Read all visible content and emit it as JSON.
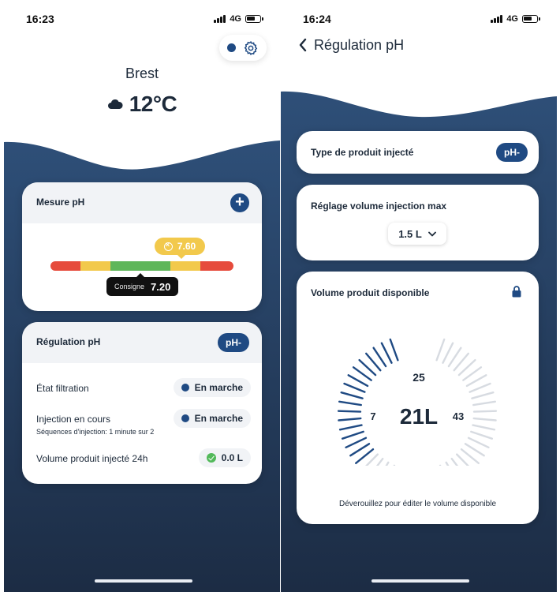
{
  "screen1": {
    "status": {
      "time": "16:23",
      "network": "4G"
    },
    "city": "Brest",
    "weather": {
      "icon": "cloud-icon",
      "temperature": "12°C"
    },
    "mesure_card": {
      "title": "Mesure pH",
      "add_icon": "plus-icon",
      "reading": "7.60",
      "setpoint_label": "Consigne",
      "setpoint_value": "7.20",
      "reading_position": 0.72,
      "setpoint_position": 0.5,
      "scale_colors": [
        "#e64b3c",
        "#f2c94c",
        "#5fb65a",
        "#f2c94c",
        "#e64b3c"
      ]
    },
    "regulation_card": {
      "title": "Régulation pH",
      "badge": "pH-",
      "filtration_label": "État filtration",
      "filtration_status": "En marche",
      "injection_label": "Injection en cours",
      "injection_status": "En marche",
      "injection_sequence": "Séquences d'injection: 1 minute sur 2",
      "volume_label": "Volume produit injecté 24h",
      "volume_value": "0.0 L"
    }
  },
  "screen2": {
    "status": {
      "time": "16:24",
      "network": "4G"
    },
    "title": "Régulation pH",
    "product_card": {
      "label": "Type de produit injecté",
      "badge": "pH-"
    },
    "volume_max_card": {
      "label": "Réglage volume injection max",
      "selected": "1.5 L"
    },
    "available_card": {
      "label": "Volume produit disponible",
      "lock_icon": "lock-icon",
      "gauge_top": "25",
      "gauge_left": "7",
      "gauge_right": "43",
      "gauge_value": "21L",
      "gauge_fill_fraction": 0.35,
      "hint": "Déverouillez pour éditer le volume disponible"
    }
  },
  "colors": {
    "navy_dark": "#1c2c44",
    "navy": "#2e4f78",
    "accent": "#1f4a83",
    "card_header": "#f1f3f6",
    "green": "#52b95a"
  }
}
